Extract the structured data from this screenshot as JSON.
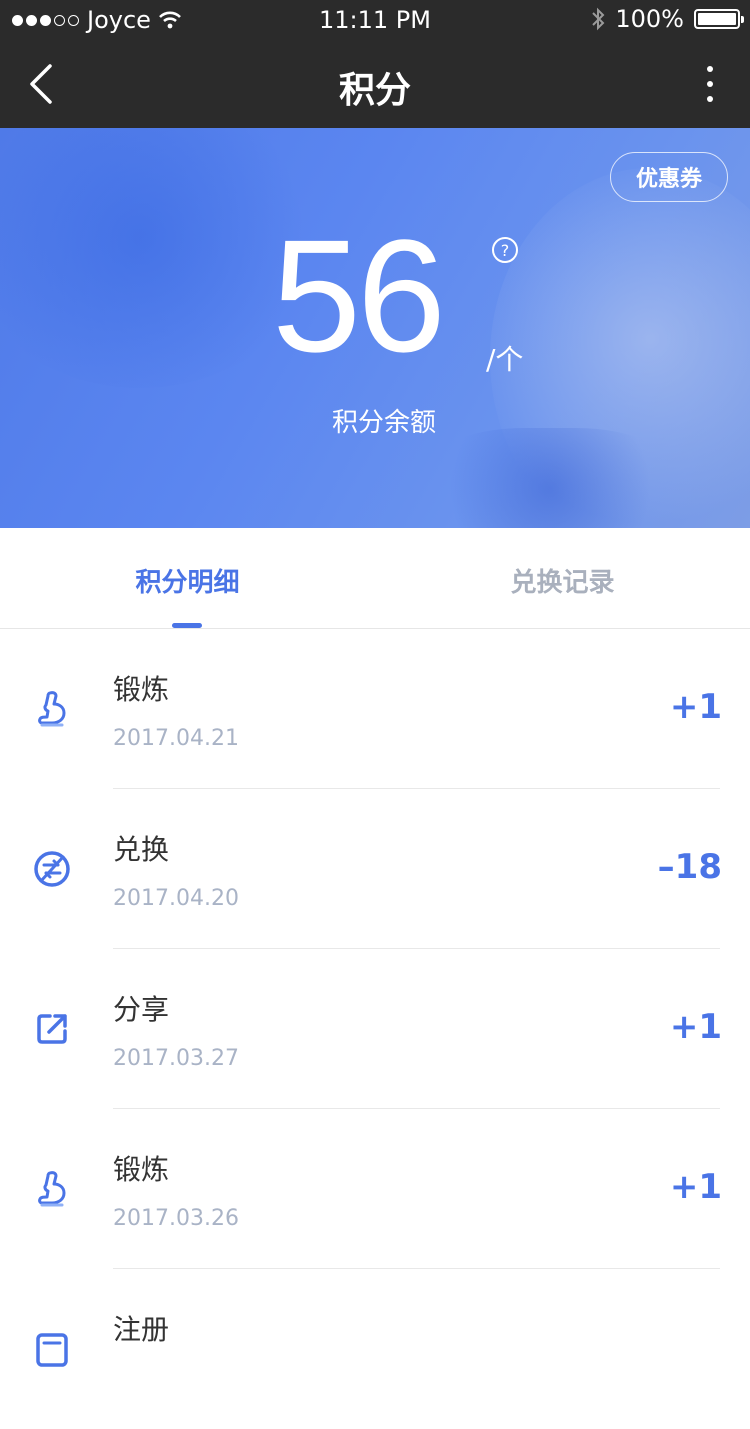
{
  "status_bar": {
    "carrier": "Joyce",
    "time": "11:11 PM",
    "battery": "100%"
  },
  "nav": {
    "title": "积分"
  },
  "hero": {
    "coupon_label": "优惠券",
    "points": "56",
    "unit": "/个",
    "label": "积分余额"
  },
  "tabs": [
    {
      "label": "积分明细",
      "active": true
    },
    {
      "label": "兑换记录",
      "active": false
    }
  ],
  "records": [
    {
      "icon": "flexed-arm-icon",
      "name": "锻炼",
      "date": "2017.04.21",
      "amount": "+1"
    },
    {
      "icon": "exchange-icon",
      "name": "兑换",
      "date": "2017.04.20",
      "amount": "–18"
    },
    {
      "icon": "share-icon",
      "name": "分享",
      "date": "2017.03.27",
      "amount": "+1"
    },
    {
      "icon": "flexed-arm-icon",
      "name": "锻炼",
      "date": "2017.03.26",
      "amount": "+1"
    },
    {
      "icon": "register-icon",
      "name": "注册",
      "date": "",
      "amount": ""
    }
  ],
  "colors": {
    "accent": "#4a74e6",
    "nav_bg": "#2b2b2b",
    "date_gray": "#a9b3c6"
  }
}
